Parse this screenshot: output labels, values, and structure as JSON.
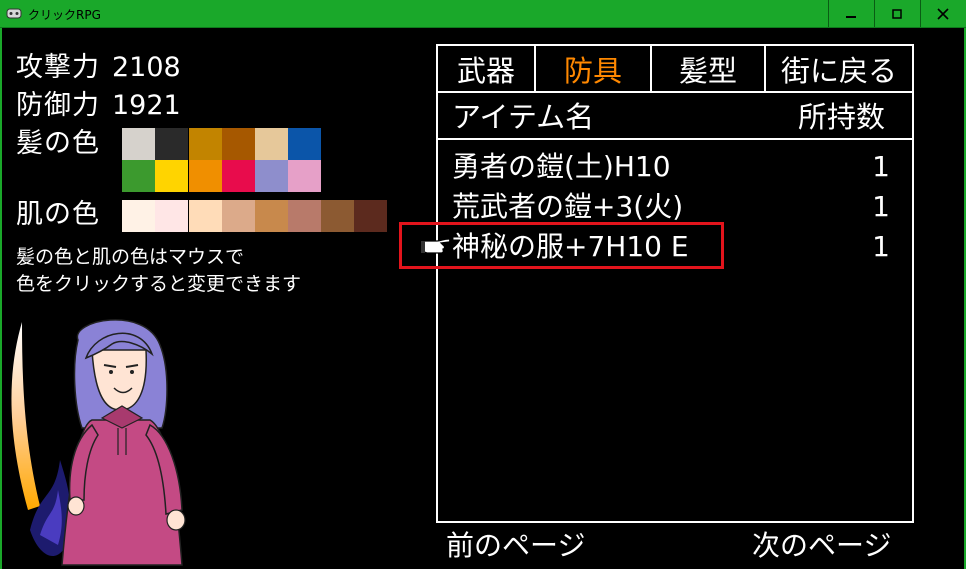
{
  "window": {
    "title": "クリックRPG",
    "min_glyph": "–",
    "max_glyph": "□",
    "close_glyph": "✕"
  },
  "stats": {
    "attack_label": "攻撃力",
    "attack_value": "2108",
    "defense_label": "防御力",
    "defense_value": "1921",
    "hair_label": "髪の色",
    "skin_label": "肌の色"
  },
  "hair_colors": [
    [
      "#d6d2cc",
      "#2a2a2a",
      "#c28400",
      "#a65800",
      "#e6c89a",
      "#0b55a9"
    ],
    [
      "#3c9a2e",
      "#ffd400",
      "#f08f00",
      "#e80c4c",
      "#8e8ecc",
      "#e6a0c8"
    ]
  ],
  "skin_colors": [
    "#fff2e6",
    "#ffe6e6",
    "#ffdcb8",
    "#dcaa8a",
    "#c8894c",
    "#b87a6a",
    "#8c5a32",
    "#5c2a1e"
  ],
  "hint": {
    "line1": "髪の色と肌の色はマウスで",
    "line2": "色をクリックすると変更できます"
  },
  "tabs": {
    "weapon": "武器",
    "armor": "防具",
    "hairstyle": "髪型",
    "back_to_town": "街に戻る"
  },
  "colors": {
    "active_tab": "#ff8800",
    "highlight_border": "#e3141c",
    "titlebar": "#1aa82a"
  },
  "table": {
    "col_item": "アイテム名",
    "col_qty": "所持数",
    "rows": [
      {
        "name": "勇者の鎧(土)H10",
        "qty": "1"
      },
      {
        "name": "荒武者の鎧+3(火)",
        "qty": "1"
      },
      {
        "name": "神秘の服+7H10 E",
        "qty": "1"
      }
    ]
  },
  "paging": {
    "prev": "前のページ",
    "next": "次のページ"
  }
}
